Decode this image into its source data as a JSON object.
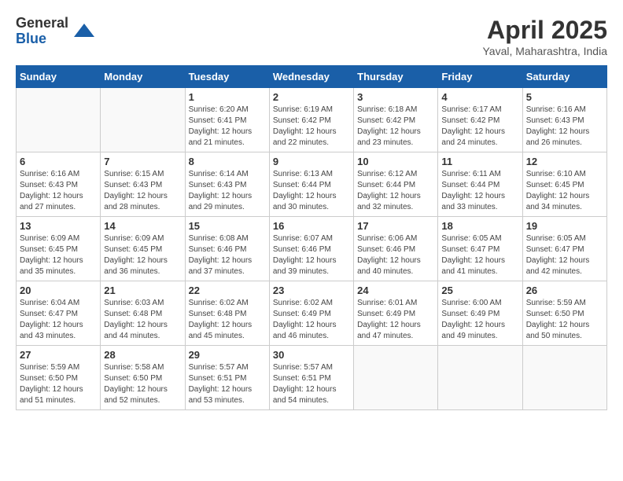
{
  "logo": {
    "general": "General",
    "blue": "Blue"
  },
  "title": "April 2025",
  "subtitle": "Yaval, Maharashtra, India",
  "days_of_week": [
    "Sunday",
    "Monday",
    "Tuesday",
    "Wednesday",
    "Thursday",
    "Friday",
    "Saturday"
  ],
  "weeks": [
    [
      {
        "day": "",
        "sunrise": "",
        "sunset": "",
        "daylight": ""
      },
      {
        "day": "",
        "sunrise": "",
        "sunset": "",
        "daylight": ""
      },
      {
        "day": "1",
        "sunrise": "Sunrise: 6:20 AM",
        "sunset": "Sunset: 6:41 PM",
        "daylight": "Daylight: 12 hours and 21 minutes."
      },
      {
        "day": "2",
        "sunrise": "Sunrise: 6:19 AM",
        "sunset": "Sunset: 6:42 PM",
        "daylight": "Daylight: 12 hours and 22 minutes."
      },
      {
        "day": "3",
        "sunrise": "Sunrise: 6:18 AM",
        "sunset": "Sunset: 6:42 PM",
        "daylight": "Daylight: 12 hours and 23 minutes."
      },
      {
        "day": "4",
        "sunrise": "Sunrise: 6:17 AM",
        "sunset": "Sunset: 6:42 PM",
        "daylight": "Daylight: 12 hours and 24 minutes."
      },
      {
        "day": "5",
        "sunrise": "Sunrise: 6:16 AM",
        "sunset": "Sunset: 6:43 PM",
        "daylight": "Daylight: 12 hours and 26 minutes."
      }
    ],
    [
      {
        "day": "6",
        "sunrise": "Sunrise: 6:16 AM",
        "sunset": "Sunset: 6:43 PM",
        "daylight": "Daylight: 12 hours and 27 minutes."
      },
      {
        "day": "7",
        "sunrise": "Sunrise: 6:15 AM",
        "sunset": "Sunset: 6:43 PM",
        "daylight": "Daylight: 12 hours and 28 minutes."
      },
      {
        "day": "8",
        "sunrise": "Sunrise: 6:14 AM",
        "sunset": "Sunset: 6:43 PM",
        "daylight": "Daylight: 12 hours and 29 minutes."
      },
      {
        "day": "9",
        "sunrise": "Sunrise: 6:13 AM",
        "sunset": "Sunset: 6:44 PM",
        "daylight": "Daylight: 12 hours and 30 minutes."
      },
      {
        "day": "10",
        "sunrise": "Sunrise: 6:12 AM",
        "sunset": "Sunset: 6:44 PM",
        "daylight": "Daylight: 12 hours and 32 minutes."
      },
      {
        "day": "11",
        "sunrise": "Sunrise: 6:11 AM",
        "sunset": "Sunset: 6:44 PM",
        "daylight": "Daylight: 12 hours and 33 minutes."
      },
      {
        "day": "12",
        "sunrise": "Sunrise: 6:10 AM",
        "sunset": "Sunset: 6:45 PM",
        "daylight": "Daylight: 12 hours and 34 minutes."
      }
    ],
    [
      {
        "day": "13",
        "sunrise": "Sunrise: 6:09 AM",
        "sunset": "Sunset: 6:45 PM",
        "daylight": "Daylight: 12 hours and 35 minutes."
      },
      {
        "day": "14",
        "sunrise": "Sunrise: 6:09 AM",
        "sunset": "Sunset: 6:45 PM",
        "daylight": "Daylight: 12 hours and 36 minutes."
      },
      {
        "day": "15",
        "sunrise": "Sunrise: 6:08 AM",
        "sunset": "Sunset: 6:46 PM",
        "daylight": "Daylight: 12 hours and 37 minutes."
      },
      {
        "day": "16",
        "sunrise": "Sunrise: 6:07 AM",
        "sunset": "Sunset: 6:46 PM",
        "daylight": "Daylight: 12 hours and 39 minutes."
      },
      {
        "day": "17",
        "sunrise": "Sunrise: 6:06 AM",
        "sunset": "Sunset: 6:46 PM",
        "daylight": "Daylight: 12 hours and 40 minutes."
      },
      {
        "day": "18",
        "sunrise": "Sunrise: 6:05 AM",
        "sunset": "Sunset: 6:47 PM",
        "daylight": "Daylight: 12 hours and 41 minutes."
      },
      {
        "day": "19",
        "sunrise": "Sunrise: 6:05 AM",
        "sunset": "Sunset: 6:47 PM",
        "daylight": "Daylight: 12 hours and 42 minutes."
      }
    ],
    [
      {
        "day": "20",
        "sunrise": "Sunrise: 6:04 AM",
        "sunset": "Sunset: 6:47 PM",
        "daylight": "Daylight: 12 hours and 43 minutes."
      },
      {
        "day": "21",
        "sunrise": "Sunrise: 6:03 AM",
        "sunset": "Sunset: 6:48 PM",
        "daylight": "Daylight: 12 hours and 44 minutes."
      },
      {
        "day": "22",
        "sunrise": "Sunrise: 6:02 AM",
        "sunset": "Sunset: 6:48 PM",
        "daylight": "Daylight: 12 hours and 45 minutes."
      },
      {
        "day": "23",
        "sunrise": "Sunrise: 6:02 AM",
        "sunset": "Sunset: 6:49 PM",
        "daylight": "Daylight: 12 hours and 46 minutes."
      },
      {
        "day": "24",
        "sunrise": "Sunrise: 6:01 AM",
        "sunset": "Sunset: 6:49 PM",
        "daylight": "Daylight: 12 hours and 47 minutes."
      },
      {
        "day": "25",
        "sunrise": "Sunrise: 6:00 AM",
        "sunset": "Sunset: 6:49 PM",
        "daylight": "Daylight: 12 hours and 49 minutes."
      },
      {
        "day": "26",
        "sunrise": "Sunrise: 5:59 AM",
        "sunset": "Sunset: 6:50 PM",
        "daylight": "Daylight: 12 hours and 50 minutes."
      }
    ],
    [
      {
        "day": "27",
        "sunrise": "Sunrise: 5:59 AM",
        "sunset": "Sunset: 6:50 PM",
        "daylight": "Daylight: 12 hours and 51 minutes."
      },
      {
        "day": "28",
        "sunrise": "Sunrise: 5:58 AM",
        "sunset": "Sunset: 6:50 PM",
        "daylight": "Daylight: 12 hours and 52 minutes."
      },
      {
        "day": "29",
        "sunrise": "Sunrise: 5:57 AM",
        "sunset": "Sunset: 6:51 PM",
        "daylight": "Daylight: 12 hours and 53 minutes."
      },
      {
        "day": "30",
        "sunrise": "Sunrise: 5:57 AM",
        "sunset": "Sunset: 6:51 PM",
        "daylight": "Daylight: 12 hours and 54 minutes."
      },
      {
        "day": "",
        "sunrise": "",
        "sunset": "",
        "daylight": ""
      },
      {
        "day": "",
        "sunrise": "",
        "sunset": "",
        "daylight": ""
      },
      {
        "day": "",
        "sunrise": "",
        "sunset": "",
        "daylight": ""
      }
    ]
  ]
}
